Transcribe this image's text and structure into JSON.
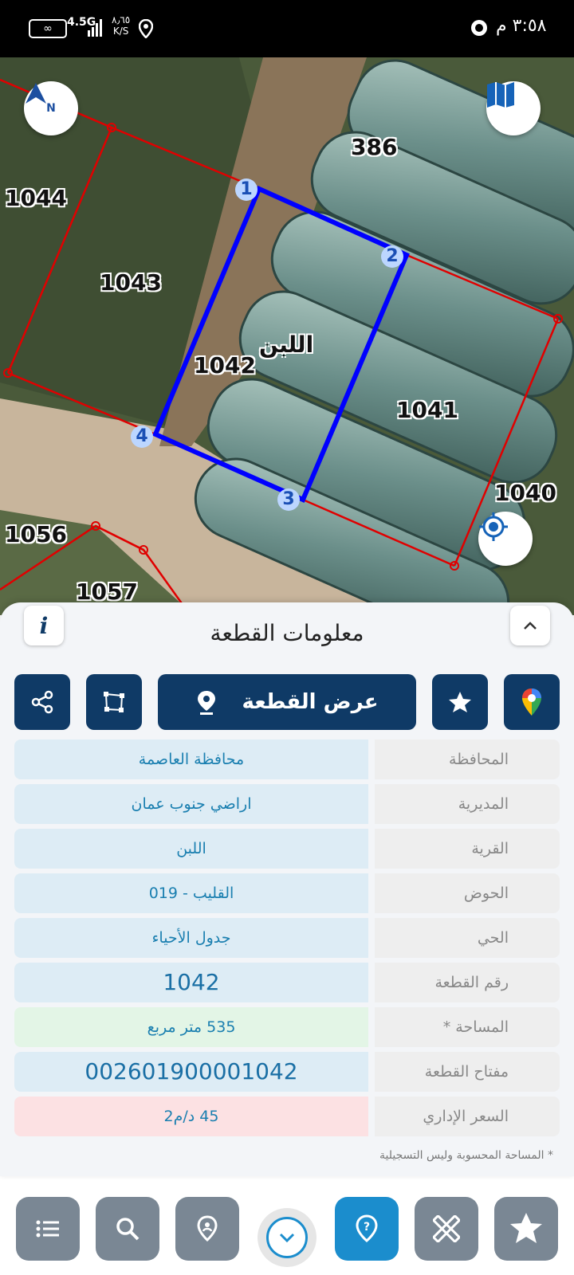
{
  "status_bar": {
    "time": "٣:٥٨ م",
    "network": "4.5G",
    "speed_value": "٨٫٦٥",
    "speed_unit": "K/S",
    "battery": "∞"
  },
  "map": {
    "parcels": [
      "386",
      "1044",
      "1043",
      "1042",
      "1041",
      "1040",
      "1056",
      "1057"
    ],
    "village_label": "اللبن",
    "vertex_labels": [
      "1",
      "2",
      "3",
      "4"
    ],
    "compass_label": "N"
  },
  "panel": {
    "title": "معلومات القطعة",
    "view_parcel_label": "عرض القطعة",
    "rows": [
      {
        "label": "المحافظة",
        "value": "محافظة العاصمة"
      },
      {
        "label": "المديرية",
        "value": "اراضي جنوب عمان"
      },
      {
        "label": "القرية",
        "value": "اللبن"
      },
      {
        "label": "الحوض",
        "value": "القليب - 019"
      },
      {
        "label": "الحي",
        "value": "جدول الأحياء"
      },
      {
        "label": "رقم القطعة",
        "value": "1042"
      },
      {
        "label": "المساحة *",
        "value": "535  متر مربع"
      },
      {
        "label": "مفتاح القطعة",
        "value": "002601900001042"
      },
      {
        "label": "السعر الإداري",
        "value": "45 د/م2"
      }
    ],
    "footnote": "* المساحة المحسوبة وليس التسجيلية"
  },
  "bottom_nav": {
    "items": [
      "list-icon",
      "search-icon",
      "location-pin-icon",
      "chevron-down-icon",
      "help-icon",
      "measure-icon",
      "favorite-icon"
    ],
    "active": "help-icon"
  },
  "colors": {
    "primary_dark": "#0f3a66",
    "accent": "#1b8dcd",
    "parcel_outline": "#e00000",
    "selected_outline": "#0000ff"
  }
}
